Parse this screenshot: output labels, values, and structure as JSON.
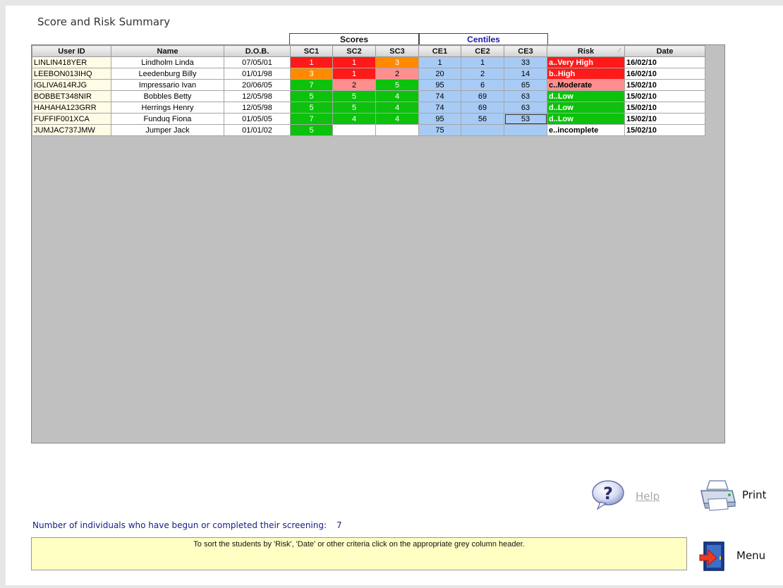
{
  "title": "Score and Risk Summary",
  "groups": {
    "scores": "Scores",
    "centiles": "Centiles"
  },
  "columns": [
    "User ID",
    "Name",
    "D.O.B.",
    "SC1",
    "SC2",
    "SC3",
    "CE1",
    "CE2",
    "CE3",
    "Risk",
    "Date"
  ],
  "rows": [
    {
      "cells": [
        "LINLIN418YER",
        "Lindholm Linda",
        "07/05/01",
        "1",
        "1",
        "3",
        "1",
        "1",
        "33",
        "a..Very High",
        "16/02/10"
      ],
      "colors": [
        "",
        "",
        "",
        "#ff1a1a",
        "#ff1a1a",
        "#ff8a00",
        "#a7cbf5",
        "#a7cbf5",
        "#a7cbf5",
        "#ff1a1a",
        ""
      ]
    },
    {
      "cells": [
        "LEEBON013IHQ",
        "Leedenburg Billy",
        "01/01/98",
        "3",
        "1",
        "2",
        "20",
        "2",
        "14",
        "b..High",
        "16/02/10"
      ],
      "colors": [
        "",
        "",
        "",
        "#ff8a00",
        "#ff1a1a",
        "#ff8f8f",
        "#a7cbf5",
        "#a7cbf5",
        "#a7cbf5",
        "#ff1a1a",
        ""
      ]
    },
    {
      "cells": [
        "IGLIVA614RJG",
        "Impressario Ivan",
        "20/06/05",
        "7",
        "2",
        "5",
        "95",
        "6",
        "65",
        "c..Moderate",
        "15/02/10"
      ],
      "colors": [
        "",
        "",
        "",
        "#0cc20c",
        "#ff8f8f",
        "#0cc20c",
        "#a7cbf5",
        "#a7cbf5",
        "#a7cbf5",
        "#ff8f8f",
        ""
      ]
    },
    {
      "cells": [
        "BOBBET348NIR",
        "Bobbles Betty",
        "12/05/98",
        "5",
        "5",
        "4",
        "74",
        "69",
        "63",
        "d..Low",
        "15/02/10"
      ],
      "colors": [
        "",
        "",
        "",
        "#0cc20c",
        "#0cc20c",
        "#0cc20c",
        "#a7cbf5",
        "#a7cbf5",
        "#a7cbf5",
        "#0cc20c",
        ""
      ]
    },
    {
      "cells": [
        "HAHAHA123GRR",
        "Herrings Henry",
        "12/05/98",
        "5",
        "5",
        "4",
        "74",
        "69",
        "63",
        "d..Low",
        "15/02/10"
      ],
      "colors": [
        "",
        "",
        "",
        "#0cc20c",
        "#0cc20c",
        "#0cc20c",
        "#a7cbf5",
        "#a7cbf5",
        "#a7cbf5",
        "#0cc20c",
        ""
      ]
    },
    {
      "cells": [
        "FUFFIF001XCA",
        "Funduq Fiona",
        "01/05/05",
        "7",
        "4",
        "4",
        "95",
        "56",
        "53",
        "d..Low",
        "15/02/10"
      ],
      "colors": [
        "",
        "",
        "",
        "#0cc20c",
        "#0cc20c",
        "#0cc20c",
        "#a7cbf5",
        "#a7cbf5",
        "#a7cbf5",
        "#0cc20c",
        ""
      ]
    },
    {
      "cells": [
        "JUMJAC737JMW",
        "Jumper Jack",
        "01/01/02",
        "5",
        "",
        "",
        "75",
        "",
        "",
        "e..incomplete",
        "15/02/10"
      ],
      "colors": [
        "",
        "",
        "",
        "#0cc20c",
        "",
        "",
        "#a7cbf5",
        "#a7cbf5",
        "#a7cbf5",
        "",
        ""
      ]
    }
  ],
  "help_label": "Help",
  "print_label": "Print",
  "menu_label": "Menu",
  "count_text": "Number of individuals who have begun or completed their screening:",
  "count_value": "7",
  "hint_text": "To sort the students by 'Risk', 'Date' or other criteria click on the appropriate grey column header."
}
